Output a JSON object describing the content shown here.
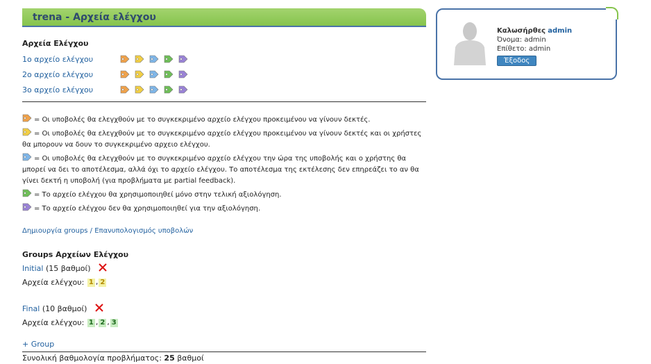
{
  "title": "trena - Αρχεία ελέγχου",
  "checkers": {
    "heading": "Αρχεία Ελέγχου",
    "items": [
      {
        "label": "1ο αρχείο ελέγχου"
      },
      {
        "label": "2ο αρχείο ελέγχου"
      },
      {
        "label": "3ο αρχείο ελέγχου"
      }
    ],
    "tag_icons": [
      "tag-orange-icon",
      "tag-yellow-icon",
      "tag-blue-icon",
      "tag-green-icon",
      "tag-purple-icon"
    ]
  },
  "colors": {
    "orange": "#f0a24a",
    "yellow": "#f2cf45",
    "blue": "#7fb6e8",
    "green": "#6fbf58",
    "purple": "#9a83d6",
    "title_green": "#86c44d",
    "border_blue": "#4a73a8"
  },
  "legend": [
    {
      "icon": "tag-orange-icon",
      "text": "= Οι υποβολές θα ελεγχθούν με το συγκεκριμένο αρχείο ελέγχου προκειμένου να γίνουν δεκτές."
    },
    {
      "icon": "tag-yellow-icon",
      "text": "= Οι υποβολές θα ελεγχθούν με το συγκεκριμένο αρχείο ελέγχου προκειμένου να γίνουν δεκτές και οι χρήστες θα μπορουν να δουν το συγκεκριμένο αρχειο ελέγχου."
    },
    {
      "icon": "tag-blue-icon",
      "text": "= Οι υποβολές θα ελεγχθούν με το συγκεκριμένο αρχείο ελέγχου την ώρα της υποβολής και ο χρήστης θα μπορεί να δει το αποτέλεσμα, αλλά όχι το αρχείο ελέγχου. Το αποτέλεσμα της εκτέλεσης δεν επηρεάζει το αν θα γίνει δεκτή η υποβολή (για προβλήματα με partial feedback)."
    },
    {
      "icon": "tag-green-icon",
      "text": "= Το αρχείο ελέγχου θα χρησιμοποιηθεί μόνο στην τελική αξιολόγηση."
    },
    {
      "icon": "tag-purple-icon",
      "text": "= Το αρχείο ελέγχου δεν θα χρησιμοποιηθεί για την αξιολόγηση."
    }
  ],
  "groups_link": "Δημιουργία groups / Επανυπολογισμός υποβολών",
  "groups": {
    "heading": "Groups Αρχείων Ελέγχου",
    "checkers_label": "Αρχεία ελέγχου:",
    "items": [
      {
        "name": "Initial",
        "points": "(15 βαθμοί)",
        "checkers": [
          "1",
          "2"
        ],
        "chip_color": "yellow"
      },
      {
        "name": "Final",
        "points": "(10 βαθμοί)",
        "checkers": [
          "1",
          "2",
          "3"
        ],
        "chip_color": "green"
      }
    ],
    "add_label": "+ Group"
  },
  "total": {
    "label": "Συνολική βαθμολογία προβλήματος:",
    "value": "25",
    "unit": "βαθμοί"
  },
  "user": {
    "greeting": "Καλωσήρθες",
    "username": "admin",
    "first_name_line": "Όνομα: admin",
    "last_name_line": "Επίθετο: admin",
    "logout_label": "Έξοδος"
  }
}
